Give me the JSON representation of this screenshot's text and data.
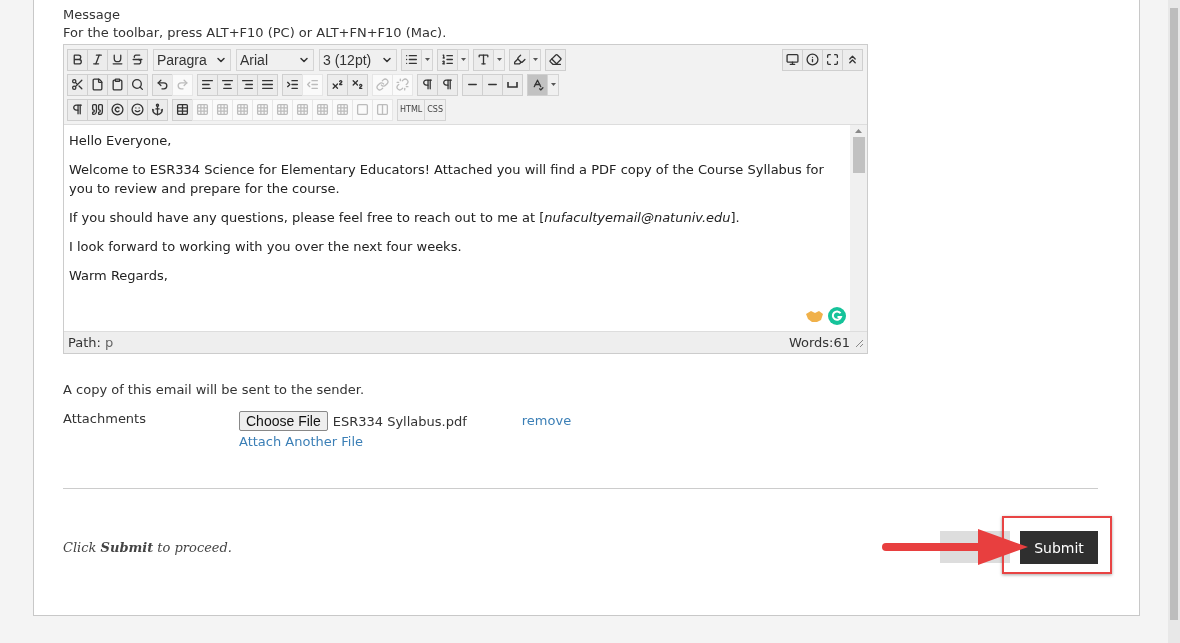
{
  "message_label": "Message",
  "toolbar_hint": "For the toolbar, press ALT+F10 (PC) or ALT+FN+F10 (Mac).",
  "toolbar": [
    [
      {
        "kind": "button",
        "disabled": false,
        "pressed": false
      },
      {
        "kind": "button",
        "disabled": false,
        "pressed": false
      },
      {
        "kind": "button",
        "disabled": false,
        "pressed": false
      },
      {
        "kind": "button",
        "disabled": false,
        "pressed": false
      },
      {
        "kind": "gap"
      },
      {
        "kind": "select",
        "value": "Paragra"
      },
      {
        "kind": "gap"
      },
      {
        "kind": "select",
        "value": "Arial"
      },
      {
        "kind": "gap"
      },
      {
        "kind": "select",
        "value": "3 (12pt)"
      },
      {
        "kind": "gap"
      },
      {
        "kind": "button",
        "disabled": false,
        "pressed": false
      },
      {
        "kind": "caret"
      },
      {
        "kind": "gap"
      },
      {
        "kind": "button",
        "disabled": false,
        "pressed": false
      },
      {
        "kind": "caret"
      },
      {
        "kind": "gap"
      },
      {
        "kind": "button",
        "disabled": false,
        "pressed": false
      },
      {
        "kind": "caret"
      },
      {
        "kind": "gap"
      },
      {
        "kind": "button",
        "disabled": false,
        "pressed": false
      },
      {
        "kind": "caret"
      },
      {
        "kind": "gap"
      },
      {
        "kind": "button",
        "disabled": false,
        "pressed": false
      },
      {
        "kind": "spacer"
      },
      {
        "kind": "button",
        "disabled": false,
        "pressed": false
      },
      {
        "kind": "button",
        "disabled": false,
        "pressed": false
      },
      {
        "kind": "button",
        "disabled": false,
        "pressed": false
      },
      {
        "kind": "button",
        "disabled": false,
        "pressed": false
      }
    ],
    [
      {
        "kind": "button",
        "disabled": false,
        "pressed": false
      },
      {
        "kind": "button",
        "disabled": false,
        "pressed": false
      },
      {
        "kind": "button",
        "disabled": false,
        "pressed": false
      },
      {
        "kind": "button",
        "disabled": false,
        "pressed": false
      },
      {
        "kind": "gap"
      },
      {
        "kind": "button",
        "disabled": false,
        "pressed": false
      },
      {
        "kind": "button",
        "disabled": true,
        "pressed": false
      },
      {
        "kind": "gap"
      },
      {
        "kind": "button",
        "disabled": false,
        "pressed": false
      },
      {
        "kind": "button",
        "disabled": false,
        "pressed": false
      },
      {
        "kind": "button",
        "disabled": false,
        "pressed": false
      },
      {
        "kind": "button",
        "disabled": false,
        "pressed": false
      },
      {
        "kind": "gap"
      },
      {
        "kind": "button",
        "disabled": false,
        "pressed": false
      },
      {
        "kind": "button",
        "disabled": true,
        "pressed": false
      },
      {
        "kind": "gap"
      },
      {
        "kind": "button",
        "disabled": false,
        "pressed": false
      },
      {
        "kind": "button",
        "disabled": false,
        "pressed": false
      },
      {
        "kind": "gap"
      },
      {
        "kind": "button",
        "disabled": true,
        "pressed": false
      },
      {
        "kind": "button",
        "disabled": true,
        "pressed": false
      },
      {
        "kind": "gap"
      },
      {
        "kind": "button",
        "disabled": false,
        "pressed": false
      },
      {
        "kind": "button",
        "disabled": false,
        "pressed": false
      },
      {
        "kind": "gap"
      },
      {
        "kind": "button",
        "disabled": false,
        "pressed": false
      },
      {
        "kind": "button",
        "disabled": false,
        "pressed": false
      },
      {
        "kind": "button",
        "disabled": false,
        "pressed": false
      },
      {
        "kind": "gap"
      },
      {
        "kind": "button",
        "disabled": false,
        "pressed": true
      },
      {
        "kind": "caret"
      }
    ],
    [
      {
        "kind": "button",
        "disabled": false,
        "pressed": false
      },
      {
        "kind": "button",
        "disabled": false,
        "pressed": false
      },
      {
        "kind": "button",
        "disabled": false,
        "pressed": false
      },
      {
        "kind": "button",
        "disabled": false,
        "pressed": false
      },
      {
        "kind": "button",
        "disabled": false,
        "pressed": false
      },
      {
        "kind": "gap"
      },
      {
        "kind": "button",
        "disabled": false,
        "pressed": false
      },
      {
        "kind": "button",
        "disabled": true,
        "pressed": false
      },
      {
        "kind": "button",
        "disabled": true,
        "pressed": false
      },
      {
        "kind": "button",
        "disabled": true,
        "pressed": false
      },
      {
        "kind": "button",
        "disabled": true,
        "pressed": false
      },
      {
        "kind": "button",
        "disabled": true,
        "pressed": false
      },
      {
        "kind": "button",
        "disabled": true,
        "pressed": false
      },
      {
        "kind": "button",
        "disabled": true,
        "pressed": false
      },
      {
        "kind": "button",
        "disabled": true,
        "pressed": false
      },
      {
        "kind": "button",
        "disabled": true,
        "pressed": false
      },
      {
        "kind": "button",
        "disabled": true,
        "pressed": false
      },
      {
        "kind": "gap"
      },
      {
        "kind": "text",
        "text": "HTML"
      },
      {
        "kind": "text",
        "text": "CSS"
      }
    ]
  ],
  "body": [
    "Hello Everyone,",
    "Welcome to ESR334 Science for Elementary Educators! Attached you will find a PDF copy of the Course Syllabus for you to review and prepare for the course.",
    "If you should have any questions, please feel free to reach out to me at [*nufacultyemail@natuniv.edu*].",
    "I look forward to working with you over the next four weeks.",
    "Warm Regards,"
  ],
  "path_label": "Path:",
  "path": "p",
  "word_count": "Words:61",
  "copy_note": "A copy of this email will be sent to the sender.",
  "attachments": {
    "label": "Attachments",
    "choose_button": "Choose File",
    "file_name": "ESR334 Syllabus.pdf",
    "remove_link": "remove",
    "attach_another_link": "Attach Another File"
  },
  "footer_note": "Click **Submit** to proceed.",
  "buttons": {
    "submit": "Submit"
  }
}
